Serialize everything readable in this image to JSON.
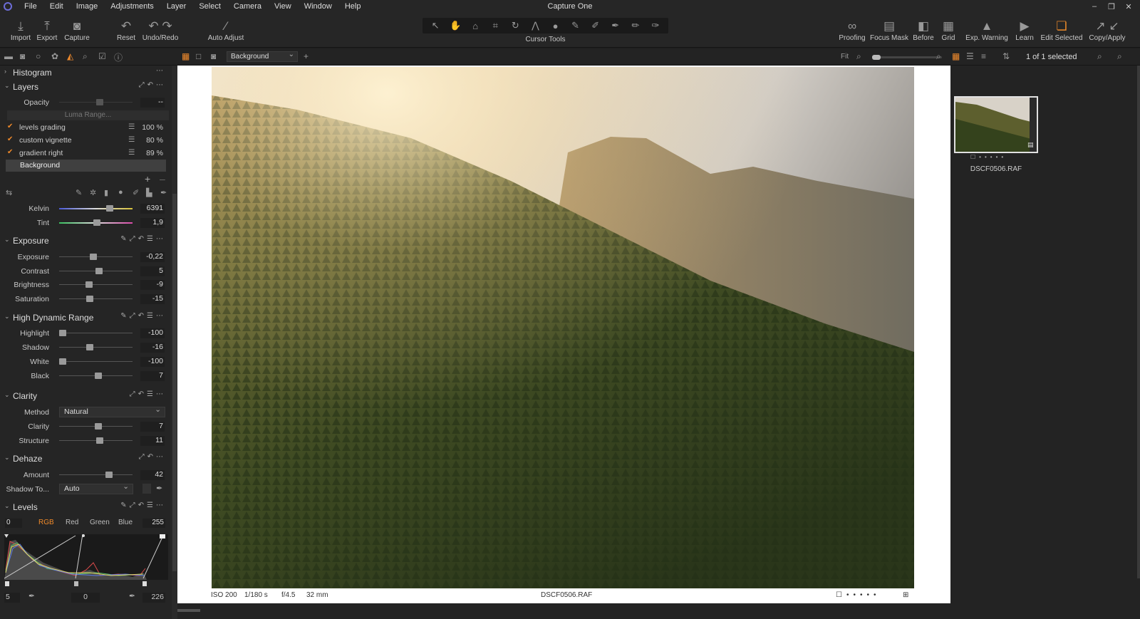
{
  "app": {
    "title": "Capture One"
  },
  "menu": [
    "File",
    "Edit",
    "Image",
    "Adjustments",
    "Layer",
    "Select",
    "Camera",
    "View",
    "Window",
    "Help"
  ],
  "toolbar": {
    "left": [
      {
        "label": "Import",
        "icon": "import-icon"
      },
      {
        "label": "Export",
        "icon": "export-icon"
      },
      {
        "label": "Capture",
        "icon": "camera-icon"
      },
      {
        "label": "Reset",
        "icon": "reset-icon"
      },
      {
        "label": "Undo/Redo",
        "icon": "undo-redo-icon"
      },
      {
        "label": "Auto Adjust",
        "icon": "magic-wand-icon"
      }
    ],
    "cursor_tools_label": "Cursor Tools",
    "right": [
      {
        "label": "Proofing",
        "icon": "glasses-icon"
      },
      {
        "label": "Focus Mask",
        "icon": "focus-mask-icon"
      },
      {
        "label": "Before",
        "icon": "before-after-icon"
      },
      {
        "label": "Grid",
        "icon": "grid-icon"
      },
      {
        "label": "Exp. Warning",
        "icon": "warning-icon"
      },
      {
        "label": "Learn",
        "icon": "learn-icon"
      },
      {
        "label": "Edit Selected",
        "icon": "edit-selected-icon"
      },
      {
        "label": "Copy/Apply",
        "icon": "copy-apply-icon"
      }
    ]
  },
  "viewer_bar": {
    "variant": "Background",
    "fit": "Fit",
    "selection": "1 of 1 selected"
  },
  "panels": {
    "histogram": {
      "title": "Histogram"
    },
    "layers": {
      "title": "Layers",
      "opacity_label": "Opacity",
      "opacity_value": "--",
      "luma_range": "Luma Range...",
      "items": [
        {
          "name": "levels grading",
          "pct": "100 %"
        },
        {
          "name": "custom vignette",
          "pct": "80 %"
        },
        {
          "name": "gradient right",
          "pct": "89 %"
        }
      ],
      "background": "Background"
    },
    "white_balance": {
      "kelvin": {
        "label": "Kelvin",
        "value": "6391",
        "pos": 0.69
      },
      "tint": {
        "label": "Tint",
        "value": "1,9",
        "pos": 0.51
      }
    },
    "exposure": {
      "title": "Exposure",
      "rows": [
        {
          "label": "Exposure",
          "value": "-0,22",
          "pos": 0.47
        },
        {
          "label": "Contrast",
          "value": "5",
          "pos": 0.54
        },
        {
          "label": "Brightness",
          "value": "-9",
          "pos": 0.41
        },
        {
          "label": "Saturation",
          "value": "-15",
          "pos": 0.42
        }
      ]
    },
    "hdr": {
      "title": "High Dynamic Range",
      "rows": [
        {
          "label": "Highlight",
          "value": "-100",
          "pos": 0.05
        },
        {
          "label": "Shadow",
          "value": "-16",
          "pos": 0.42
        },
        {
          "label": "White",
          "value": "-100",
          "pos": 0.05
        },
        {
          "label": "Black",
          "value": "7",
          "pos": 0.53
        }
      ]
    },
    "clarity": {
      "title": "Clarity",
      "method_label": "Method",
      "method_value": "Natural",
      "rows": [
        {
          "label": "Clarity",
          "value": "7",
          "pos": 0.53
        },
        {
          "label": "Structure",
          "value": "11",
          "pos": 0.55
        }
      ]
    },
    "dehaze": {
      "title": "Dehaze",
      "amount": {
        "label": "Amount",
        "value": "42",
        "pos": 0.68
      },
      "shadow_label": "Shadow To...",
      "shadow_value": "Auto"
    },
    "levels": {
      "title": "Levels",
      "tabs": [
        "RGB",
        "Red",
        "Green",
        "Blue"
      ],
      "low": "0",
      "high": "255",
      "out_low": "5",
      "mid": "0",
      "out_high": "226"
    }
  },
  "image_info": {
    "iso": "ISO 200",
    "shutter": "1/180 s",
    "aperture": "f/4.5",
    "focal": "32 mm",
    "filename": "DSCF0506.RAF"
  },
  "browser": {
    "filename": "DSCF0506.RAF"
  },
  "colors": {
    "accent": "#f08a2a",
    "panel": "#252525",
    "background": "#1e1e1e"
  }
}
